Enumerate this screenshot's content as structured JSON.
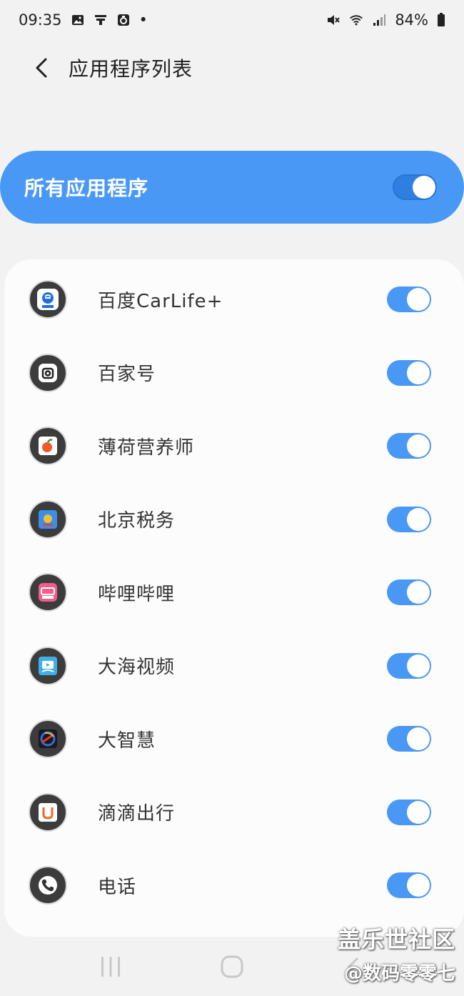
{
  "status_bar": {
    "time": "09:35",
    "dot": "•",
    "battery": "84%",
    "left_icons": [
      "gallery-icon",
      "app-notification-icon",
      "instagram-like-icon"
    ],
    "right_icons": [
      "mute-icon",
      "wifi-icon",
      "signal-icon",
      "battery-icon"
    ]
  },
  "header": {
    "title": "应用程序列表"
  },
  "all_apps": {
    "label": "所有应用程序",
    "enabled": true
  },
  "apps": [
    {
      "name": "百度CarLife+",
      "icon": "baidu-carlife-icon",
      "enabled": true
    },
    {
      "name": "百家号",
      "icon": "baijiahao-icon",
      "enabled": true
    },
    {
      "name": "薄荷营养师",
      "icon": "boohee-icon",
      "enabled": true
    },
    {
      "name": "北京税务",
      "icon": "beijing-tax-icon",
      "enabled": true
    },
    {
      "name": "哔哩哔哩",
      "icon": "bilibili-icon",
      "enabled": true
    },
    {
      "name": "大海视频",
      "icon": "dahai-video-icon",
      "enabled": true
    },
    {
      "name": "大智慧",
      "icon": "dazhihui-icon",
      "enabled": true
    },
    {
      "name": "滴滴出行",
      "icon": "didi-icon",
      "enabled": true
    },
    {
      "name": "电话",
      "icon": "phone-icon",
      "enabled": true
    }
  ],
  "watermark": {
    "line1": "盖乐世社区",
    "line2": "@数码零零七"
  },
  "colors": {
    "accent": "#4a98f5",
    "background": "#f2f2f2",
    "card": "#fcfcfc"
  }
}
